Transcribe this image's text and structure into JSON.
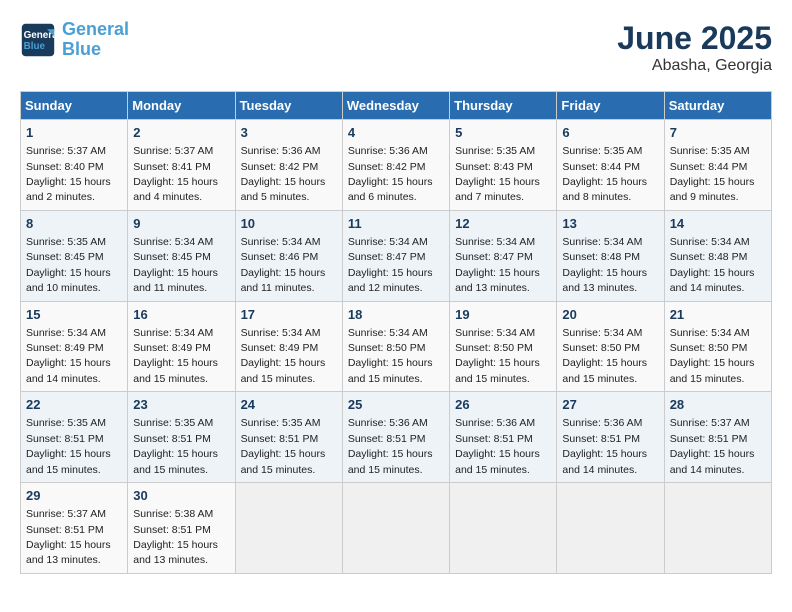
{
  "header": {
    "logo_line1": "General",
    "logo_line2": "Blue",
    "title": "June 2025",
    "subtitle": "Abasha, Georgia"
  },
  "weekdays": [
    "Sunday",
    "Monday",
    "Tuesday",
    "Wednesday",
    "Thursday",
    "Friday",
    "Saturday"
  ],
  "weeks": [
    [
      {
        "day": "1",
        "sunrise": "5:37 AM",
        "sunset": "8:40 PM",
        "daylight": "15 hours and 2 minutes."
      },
      {
        "day": "2",
        "sunrise": "5:37 AM",
        "sunset": "8:41 PM",
        "daylight": "15 hours and 4 minutes."
      },
      {
        "day": "3",
        "sunrise": "5:36 AM",
        "sunset": "8:42 PM",
        "daylight": "15 hours and 5 minutes."
      },
      {
        "day": "4",
        "sunrise": "5:36 AM",
        "sunset": "8:42 PM",
        "daylight": "15 hours and 6 minutes."
      },
      {
        "day": "5",
        "sunrise": "5:35 AM",
        "sunset": "8:43 PM",
        "daylight": "15 hours and 7 minutes."
      },
      {
        "day": "6",
        "sunrise": "5:35 AM",
        "sunset": "8:44 PM",
        "daylight": "15 hours and 8 minutes."
      },
      {
        "day": "7",
        "sunrise": "5:35 AM",
        "sunset": "8:44 PM",
        "daylight": "15 hours and 9 minutes."
      }
    ],
    [
      {
        "day": "8",
        "sunrise": "5:35 AM",
        "sunset": "8:45 PM",
        "daylight": "15 hours and 10 minutes."
      },
      {
        "day": "9",
        "sunrise": "5:34 AM",
        "sunset": "8:45 PM",
        "daylight": "15 hours and 11 minutes."
      },
      {
        "day": "10",
        "sunrise": "5:34 AM",
        "sunset": "8:46 PM",
        "daylight": "15 hours and 11 minutes."
      },
      {
        "day": "11",
        "sunrise": "5:34 AM",
        "sunset": "8:47 PM",
        "daylight": "15 hours and 12 minutes."
      },
      {
        "day": "12",
        "sunrise": "5:34 AM",
        "sunset": "8:47 PM",
        "daylight": "15 hours and 13 minutes."
      },
      {
        "day": "13",
        "sunrise": "5:34 AM",
        "sunset": "8:48 PM",
        "daylight": "15 hours and 13 minutes."
      },
      {
        "day": "14",
        "sunrise": "5:34 AM",
        "sunset": "8:48 PM",
        "daylight": "15 hours and 14 minutes."
      }
    ],
    [
      {
        "day": "15",
        "sunrise": "5:34 AM",
        "sunset": "8:49 PM",
        "daylight": "15 hours and 14 minutes."
      },
      {
        "day": "16",
        "sunrise": "5:34 AM",
        "sunset": "8:49 PM",
        "daylight": "15 hours and 15 minutes."
      },
      {
        "day": "17",
        "sunrise": "5:34 AM",
        "sunset": "8:49 PM",
        "daylight": "15 hours and 15 minutes."
      },
      {
        "day": "18",
        "sunrise": "5:34 AM",
        "sunset": "8:50 PM",
        "daylight": "15 hours and 15 minutes."
      },
      {
        "day": "19",
        "sunrise": "5:34 AM",
        "sunset": "8:50 PM",
        "daylight": "15 hours and 15 minutes."
      },
      {
        "day": "20",
        "sunrise": "5:34 AM",
        "sunset": "8:50 PM",
        "daylight": "15 hours and 15 minutes."
      },
      {
        "day": "21",
        "sunrise": "5:34 AM",
        "sunset": "8:50 PM",
        "daylight": "15 hours and 15 minutes."
      }
    ],
    [
      {
        "day": "22",
        "sunrise": "5:35 AM",
        "sunset": "8:51 PM",
        "daylight": "15 hours and 15 minutes."
      },
      {
        "day": "23",
        "sunrise": "5:35 AM",
        "sunset": "8:51 PM",
        "daylight": "15 hours and 15 minutes."
      },
      {
        "day": "24",
        "sunrise": "5:35 AM",
        "sunset": "8:51 PM",
        "daylight": "15 hours and 15 minutes."
      },
      {
        "day": "25",
        "sunrise": "5:36 AM",
        "sunset": "8:51 PM",
        "daylight": "15 hours and 15 minutes."
      },
      {
        "day": "26",
        "sunrise": "5:36 AM",
        "sunset": "8:51 PM",
        "daylight": "15 hours and 15 minutes."
      },
      {
        "day": "27",
        "sunrise": "5:36 AM",
        "sunset": "8:51 PM",
        "daylight": "15 hours and 14 minutes."
      },
      {
        "day": "28",
        "sunrise": "5:37 AM",
        "sunset": "8:51 PM",
        "daylight": "15 hours and 14 minutes."
      }
    ],
    [
      {
        "day": "29",
        "sunrise": "5:37 AM",
        "sunset": "8:51 PM",
        "daylight": "15 hours and 13 minutes."
      },
      {
        "day": "30",
        "sunrise": "5:38 AM",
        "sunset": "8:51 PM",
        "daylight": "15 hours and 13 minutes."
      },
      null,
      null,
      null,
      null,
      null
    ]
  ]
}
